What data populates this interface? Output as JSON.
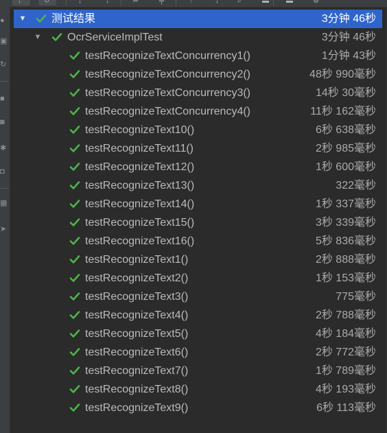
{
  "toolbar": {
    "buttons": [
      {
        "icon": "rerun-icon",
        "glyph": "↓"
      },
      {
        "icon": "toggle-auto-test-icon",
        "glyph": "↻"
      },
      {
        "icon": "sort-alphabetically-icon",
        "glyph": "↕"
      },
      {
        "icon": "sort-by-duration-icon",
        "glyph": "↕"
      },
      {
        "icon": "expand-all-icon",
        "glyph": "═"
      },
      {
        "icon": "collapse-all-icon",
        "glyph": "╤"
      },
      {
        "icon": "previous-failed-icon",
        "glyph": "↑"
      },
      {
        "icon": "next-failed-icon",
        "glyph": "↓"
      },
      {
        "icon": "search-icon",
        "glyph": "⌕"
      },
      {
        "icon": "export-icon",
        "glyph": "▬"
      },
      {
        "icon": "import-icon",
        "glyph": "▬"
      },
      {
        "icon": "settings-icon",
        "glyph": "⚙"
      }
    ]
  },
  "sidebar": {
    "icons": [
      "rerun-failed-icon",
      "stop-icon",
      "rerun-icon",
      "pause-icon",
      "camera-icon",
      "bug-icon",
      "coverage-icon",
      "layout-icon",
      "pin-icon"
    ]
  },
  "colors": {
    "pass_green": "#4fb349",
    "selection": "#2f65ca",
    "background": "#2b2b2b"
  },
  "tree": {
    "root": {
      "name": "测试结果",
      "duration": "3分钟 46秒",
      "status": "passed",
      "expanded": true
    },
    "suite": {
      "name": "OcrServiceImplTest",
      "duration": "3分钟 46秒",
      "status": "passed",
      "expanded": true
    },
    "tests": [
      {
        "name": "testRecognizeTextConcurrency1()",
        "duration": "1分钟 43秒"
      },
      {
        "name": "testRecognizeTextConcurrency2()",
        "duration": "48秒 990毫秒"
      },
      {
        "name": "testRecognizeTextConcurrency3()",
        "duration": "14秒 30毫秒"
      },
      {
        "name": "testRecognizeTextConcurrency4()",
        "duration": "11秒 162毫秒"
      },
      {
        "name": "testRecognizeText10()",
        "duration": "6秒 638毫秒"
      },
      {
        "name": "testRecognizeText11()",
        "duration": "2秒 985毫秒"
      },
      {
        "name": "testRecognizeText12()",
        "duration": "1秒 600毫秒"
      },
      {
        "name": "testRecognizeText13()",
        "duration": "322毫秒"
      },
      {
        "name": "testRecognizeText14()",
        "duration": "1秒 337毫秒"
      },
      {
        "name": "testRecognizeText15()",
        "duration": "3秒 339毫秒"
      },
      {
        "name": "testRecognizeText16()",
        "duration": "5秒 836毫秒"
      },
      {
        "name": "testRecognizeText1()",
        "duration": "2秒 888毫秒"
      },
      {
        "name": "testRecognizeText2()",
        "duration": "1秒 153毫秒"
      },
      {
        "name": "testRecognizeText3()",
        "duration": "775毫秒"
      },
      {
        "name": "testRecognizeText4()",
        "duration": "2秒 788毫秒"
      },
      {
        "name": "testRecognizeText5()",
        "duration": "4秒 184毫秒"
      },
      {
        "name": "testRecognizeText6()",
        "duration": "2秒 772毫秒"
      },
      {
        "name": "testRecognizeText7()",
        "duration": "1秒 789毫秒"
      },
      {
        "name": "testRecognizeText8()",
        "duration": "4秒 193毫秒"
      },
      {
        "name": "testRecognizeText9()",
        "duration": "6秒 113毫秒"
      }
    ]
  }
}
